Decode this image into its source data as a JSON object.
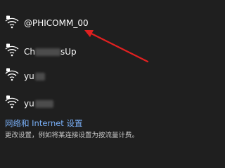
{
  "networks": [
    {
      "name": "@PHICOMM_00",
      "icon": "wifi-secured-icon"
    },
    {
      "name_prefix": "Ch",
      "name_suffix": "sUp",
      "icon": "wifi-secured-icon"
    },
    {
      "name_prefix": "yu",
      "icon": "wifi-secured-icon"
    },
    {
      "name_prefix": "yu",
      "icon": "wifi-secured-icon"
    }
  ],
  "footer": {
    "settings_link": "网络和 Internet 设置",
    "settings_desc": "更改设置，例如将某连接设置为按流量计费。"
  },
  "colors": {
    "background": "#1f1f1f",
    "text": "#ffffff",
    "link": "#78aef5",
    "annotation_arrow": "#e02020"
  }
}
